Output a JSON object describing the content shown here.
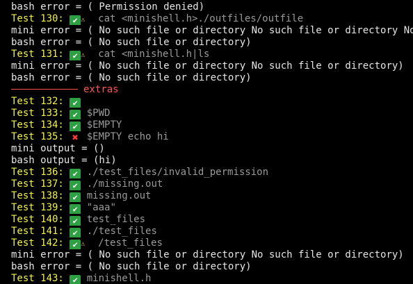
{
  "colors": {
    "background": "#000000",
    "label": "#f2f24d",
    "command": "#9a9a9a",
    "text": "#e6e6e6",
    "pass": "#2ea043",
    "fail": "#ff3b3b",
    "warning": "#f2c94c",
    "separator": "#ff5555"
  },
  "lines": [
    {
      "type": "plain",
      "text": "bash error = ( Permission denied)"
    },
    {
      "type": "test",
      "label": "Test 130:",
      "status": "pass",
      "status_icon": "check-mark-icon",
      "warn": true,
      "warn_icon": "warning-icon",
      "cmd": "cat <minishell.h>./outfiles/outfile"
    },
    {
      "type": "plain",
      "text": "mini error = ( No such file or directory No such file or directory No such file or directory)"
    },
    {
      "type": "plain",
      "text": "bash error = ( No such file or directory)"
    },
    {
      "type": "test",
      "label": "Test 131:",
      "status": "pass",
      "status_icon": "check-mark-icon",
      "warn": true,
      "warn_icon": "warning-icon",
      "cmd": "cat <minishell.h|ls"
    },
    {
      "type": "plain",
      "text": "mini error = ( No such file or directory No such file or directory)"
    },
    {
      "type": "plain",
      "text": "bash error = ( No such file or directory)"
    },
    {
      "type": "separator",
      "text": "extras"
    },
    {
      "type": "test",
      "label": "Test 132:",
      "status": "pass",
      "status_icon": "check-mark-icon",
      "warn": false,
      "cmd": ""
    },
    {
      "type": "test",
      "label": "Test 133:",
      "status": "pass",
      "status_icon": "check-mark-icon",
      "warn": false,
      "cmd": "$PWD"
    },
    {
      "type": "test",
      "label": "Test 134:",
      "status": "pass",
      "status_icon": "check-mark-icon",
      "warn": false,
      "cmd": "$EMPTY"
    },
    {
      "type": "test",
      "label": "Test 135:",
      "status": "fail",
      "status_icon": "cross-mark-icon",
      "warn": false,
      "cmd": "$EMPTY echo hi"
    },
    {
      "type": "plain",
      "text": "mini output = ()"
    },
    {
      "type": "plain",
      "text": "bash output = (hi)"
    },
    {
      "type": "test",
      "label": "Test 136:",
      "status": "pass",
      "status_icon": "check-mark-icon",
      "warn": false,
      "cmd": "./test_files/invalid_permission"
    },
    {
      "type": "test",
      "label": "Test 137:",
      "status": "pass",
      "status_icon": "check-mark-icon",
      "warn": false,
      "cmd": "./missing.out"
    },
    {
      "type": "test",
      "label": "Test 138:",
      "status": "pass",
      "status_icon": "check-mark-icon",
      "warn": false,
      "cmd": "missing.out"
    },
    {
      "type": "test",
      "label": "Test 139:",
      "status": "pass",
      "status_icon": "check-mark-icon",
      "warn": false,
      "cmd": "\"aaa\""
    },
    {
      "type": "test",
      "label": "Test 140:",
      "status": "pass",
      "status_icon": "check-mark-icon",
      "warn": false,
      "cmd": "test_files"
    },
    {
      "type": "test",
      "label": "Test 141:",
      "status": "pass",
      "status_icon": "check-mark-icon",
      "warn": false,
      "cmd": "./test_files"
    },
    {
      "type": "test",
      "label": "Test 142:",
      "status": "pass",
      "status_icon": "check-mark-icon",
      "warn": true,
      "warn_icon": "warning-icon",
      "cmd": "/test_files"
    },
    {
      "type": "plain",
      "text": "mini error = ( No such file or directory No such file or directory)"
    },
    {
      "type": "plain",
      "text": "bash error = ( No such file or directory)"
    },
    {
      "type": "test",
      "label": "Test 143:",
      "status": "pass",
      "status_icon": "check-mark-icon",
      "warn": false,
      "cmd": "minishell.h"
    }
  ]
}
